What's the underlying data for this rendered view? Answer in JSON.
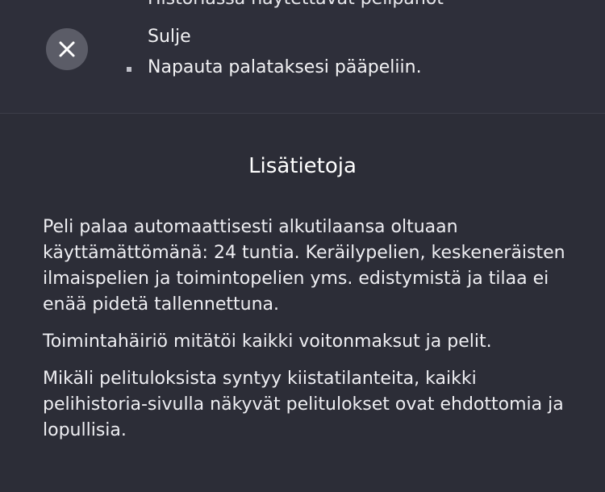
{
  "top": {
    "cut_line": "Historiassa näytettävät pelipanot"
  },
  "close": {
    "icon": "close-icon",
    "title": "Sulje",
    "description": "Napauta palataksesi pääpeliin."
  },
  "info": {
    "title": "Lisätietoja",
    "paragraphs": [
      "Peli palaa automaattisesti alkutilaansa oltuaan käyttämättömänä: 24 tuntia. Keräilypelien, keskeneräisten ilmaispelien ja toimintopelien yms. edistymistä ja tilaa ei enää pidetä tallennettuna.",
      "Toimintahäiriö mitätöi kaikki voitonmaksut ja pelit.",
      "Mikäli pelituloksista syntyy kiistatilanteita, kaikki pelihistoria-sivulla näkyvät pelitulokset ovat ehdottomia ja lopullisia."
    ]
  },
  "colors": {
    "background": "#2c2d37",
    "close_button": "#5b5c67",
    "text": "#f2f2f4"
  }
}
